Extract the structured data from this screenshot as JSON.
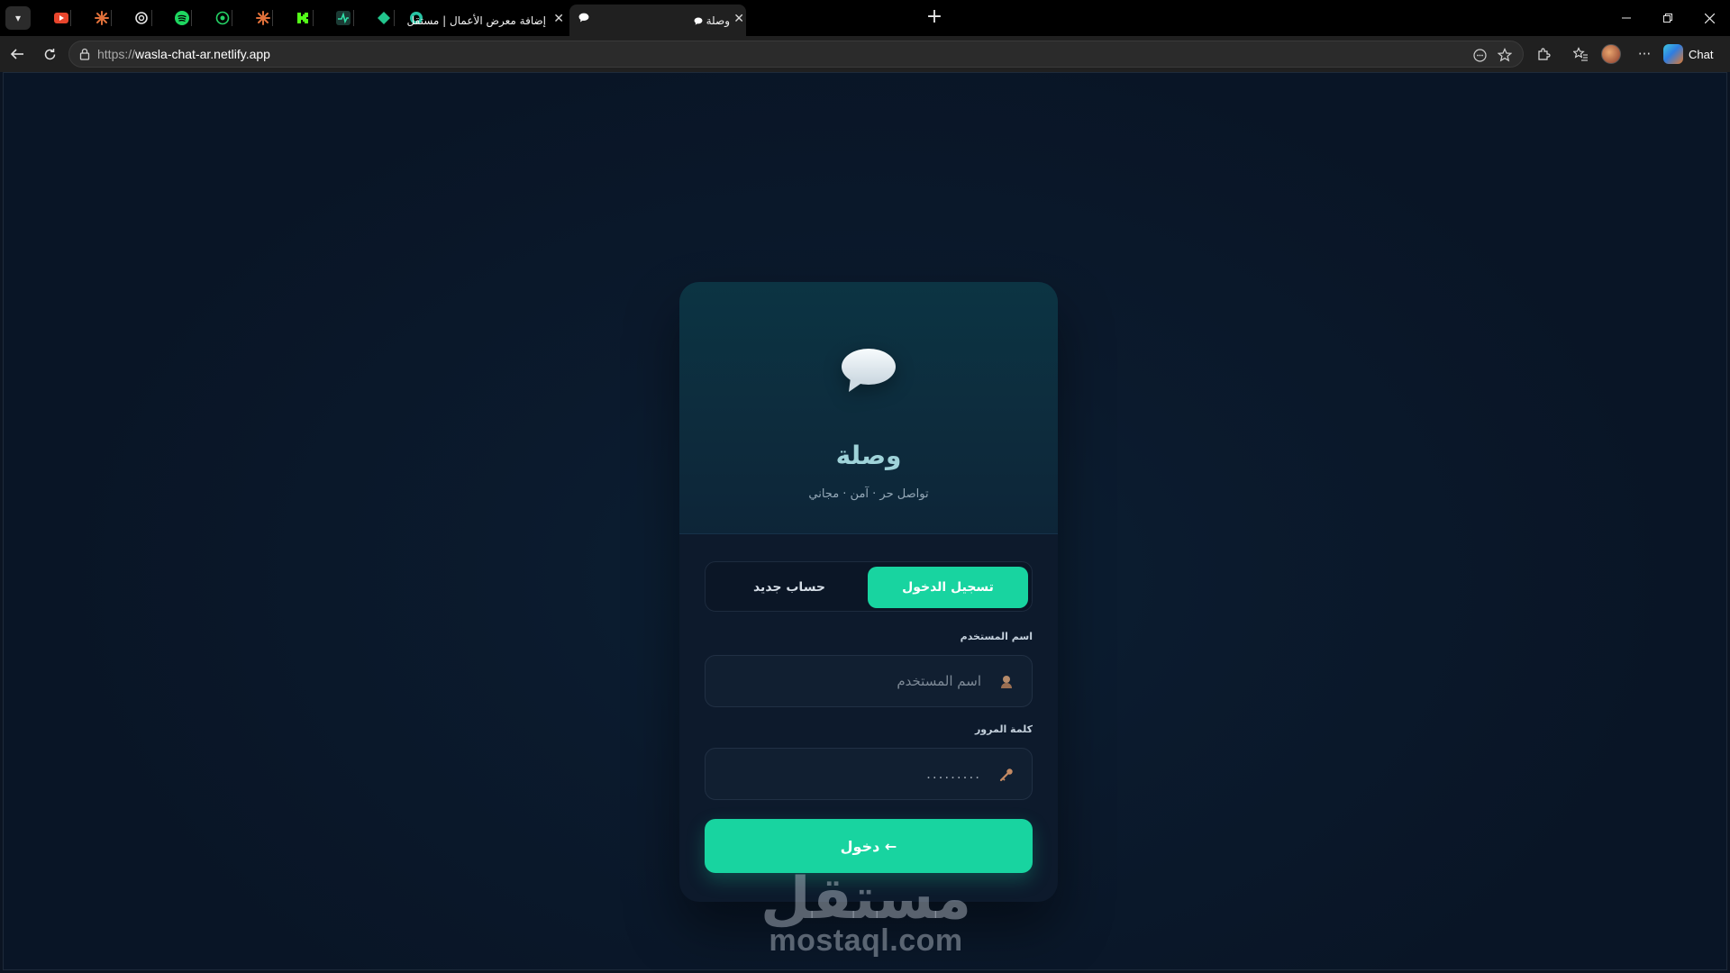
{
  "browser": {
    "tabs": [
      {
        "title": "إضافة معرض الأعمال | مستقل",
        "active": false
      },
      {
        "title": "",
        "active": false
      },
      {
        "title": "وصلة",
        "active": true
      }
    ],
    "pinned_tabs": [
      "youtube-icon",
      "claude-icon",
      "chatgpt-icon",
      "spotify-icon",
      "whatsapp-icon",
      "claude-icon",
      "kick-icon",
      "activity-icon",
      "diamond-icon",
      "circle-app-icon"
    ],
    "url_protocol": "https://",
    "url_host": "wasla-chat-ar.netlify.app",
    "chat_label": "Chat"
  },
  "app": {
    "brand": "وصلة",
    "tagline": "تواصل حر · آمن · مجاني",
    "tabs": {
      "login": "تسجيل الدخول",
      "register": "حساب جديد"
    },
    "username": {
      "label": "اسم المستخدم",
      "placeholder": "اسم المستخدم",
      "value": ""
    },
    "password": {
      "label": "كلمة المرور",
      "placeholder": "",
      "value": "........."
    },
    "submit_label": "دخول ←",
    "accent_color": "#18d4a0"
  },
  "watermark": {
    "arabic": "مستقل",
    "latin": "mostaql.com"
  }
}
